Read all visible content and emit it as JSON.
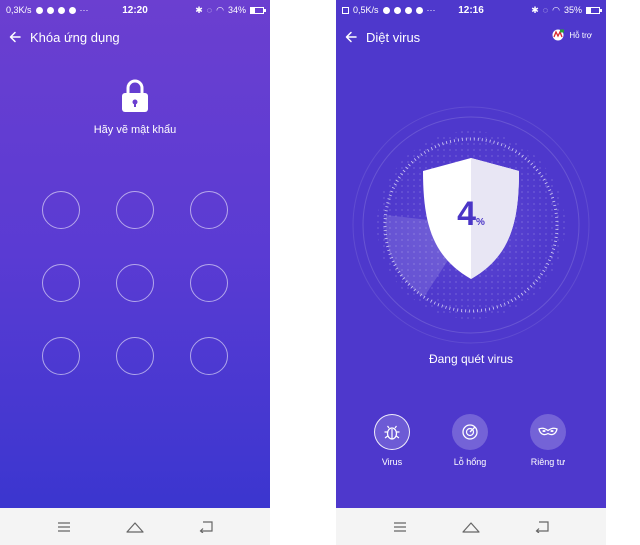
{
  "left_screen": {
    "status": {
      "speed": "0,3K/s",
      "time": "12:20",
      "battery": "34%",
      "battery_level": 0.34
    },
    "title": "Khóa ứng dụng",
    "prompt": "Hãy vẽ mật khẩu",
    "pattern_dots": 9,
    "icons": [
      "back-arrow-icon",
      "lock-icon"
    ],
    "colors": {
      "gradient_top": "#6b3fd0",
      "gradient_bottom": "#3b36cf"
    }
  },
  "right_screen": {
    "status": {
      "speed": "0,5K/s",
      "time": "12:16",
      "battery": "35%",
      "battery_level": 0.35
    },
    "title": "Diệt virus",
    "help_label": "Hỗ trợ",
    "progress_number": "4",
    "progress_sign": "%",
    "progress": 0.04,
    "scan_status": "Đang quét virus",
    "features": [
      {
        "label": "Virus",
        "icon": "bug-icon",
        "active": true
      },
      {
        "label": "Lỗ hổng",
        "icon": "target-icon",
        "active": false
      },
      {
        "label": "Riêng tư",
        "icon": "mask-icon",
        "active": false
      }
    ],
    "colors": {
      "background": "#4e38cc",
      "shield_text": "#4a35c6"
    }
  },
  "navbar": {
    "icons": [
      "menu-icon",
      "home-icon",
      "back-icon"
    ],
    "background": "#f4f4f4"
  }
}
